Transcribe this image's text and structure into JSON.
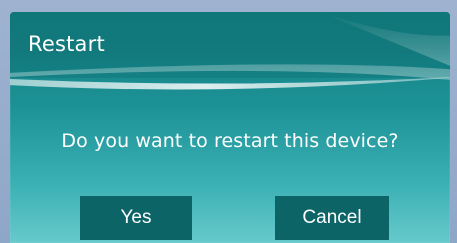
{
  "dialog": {
    "title": "Restart",
    "message": "Do you want to restart this device?",
    "buttons": {
      "yes_label": "Yes",
      "cancel_label": "Cancel"
    }
  },
  "colors": {
    "dialog_top": "#157f83",
    "dialog_bottom": "#67c9cb",
    "button_bg": "#0d6467",
    "background": "#8fa6c6"
  }
}
